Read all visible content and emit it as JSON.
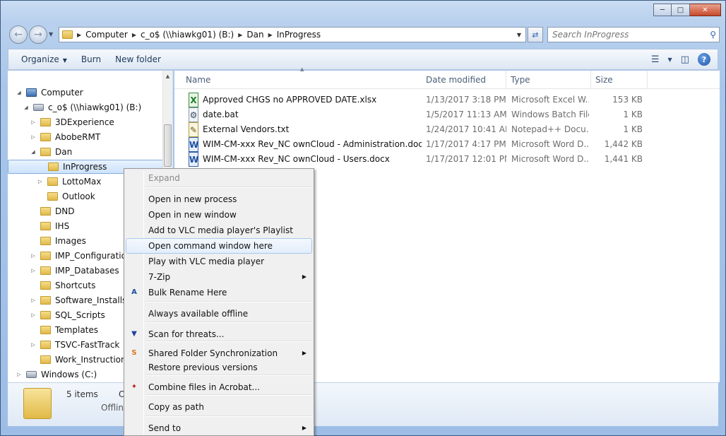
{
  "window": {
    "caption_buttons": [
      "minimize",
      "maximize",
      "close"
    ]
  },
  "address_bar": {
    "crumbs": [
      "Computer",
      "c_o$ (\\\\hiawkg01) (B:)",
      "Dan",
      "InProgress"
    ]
  },
  "search": {
    "placeholder": "Search InProgress"
  },
  "toolbar": {
    "organize": "Organize",
    "burn": "Burn",
    "new_folder": "New folder"
  },
  "nav_tree": [
    {
      "label": "Computer",
      "icon": "computer-icon",
      "expanded": true
    },
    {
      "label": "c_o$ (\\\\hiawkg01) (B:)",
      "icon": "network-drive-icon",
      "expanded": true
    },
    {
      "label": "3DExperience",
      "icon": "folder-icon"
    },
    {
      "label": "AbobeRMT",
      "icon": "folder-icon"
    },
    {
      "label": "Dan",
      "icon": "folder-icon",
      "expanded": true
    },
    {
      "label": "InProgress",
      "icon": "folder-icon",
      "selected": true
    },
    {
      "label": "LottoMax",
      "icon": "folder-icon"
    },
    {
      "label": "Outlook",
      "icon": "folder-icon"
    },
    {
      "label": "DND",
      "icon": "folder-icon"
    },
    {
      "label": "IHS",
      "icon": "folder-icon"
    },
    {
      "label": "Images",
      "icon": "folder-icon"
    },
    {
      "label": "IMP_Configuration",
      "icon": "folder-icon"
    },
    {
      "label": "IMP_Databases",
      "icon": "folder-icon"
    },
    {
      "label": "Shortcuts",
      "icon": "folder-icon"
    },
    {
      "label": "Software_Installs",
      "icon": "folder-icon"
    },
    {
      "label": "SQL_Scripts",
      "icon": "folder-icon"
    },
    {
      "label": "Templates",
      "icon": "folder-icon"
    },
    {
      "label": "TSVC-FastTrack",
      "icon": "folder-icon"
    },
    {
      "label": "Work_Instructions",
      "icon": "folder-icon"
    },
    {
      "label": "Windows (C:)",
      "icon": "local-drive-icon"
    }
  ],
  "columns": [
    "Name",
    "Date modified",
    "Type",
    "Size"
  ],
  "files": [
    {
      "name": "Approved CHGS no APPROVED DATE.xlsx",
      "date": "1/13/2017 3:18 PM",
      "type": "Microsoft Excel W...",
      "size": "153 KB",
      "icon": "excel-file-icon"
    },
    {
      "name": "date.bat",
      "date": "1/5/2017 11:13 AM",
      "type": "Windows Batch File",
      "size": "1 KB",
      "icon": "batch-file-icon"
    },
    {
      "name": "External Vendors.txt",
      "date": "1/24/2017 10:41 AM",
      "type": "Notepad++ Docu...",
      "size": "1 KB",
      "icon": "text-file-icon"
    },
    {
      "name": "WIM-CM-xxx Rev_NC ownCloud - Administration.docx",
      "date": "1/17/2017 4:17 PM",
      "type": "Microsoft Word D...",
      "size": "1,442 KB",
      "icon": "word-file-icon"
    },
    {
      "name": "WIM-CM-xxx Rev_NC ownCloud - Users.docx",
      "date": "1/17/2017 12:01 PM",
      "type": "Microsoft Word D...",
      "size": "1,441 KB",
      "icon": "word-file-icon"
    }
  ],
  "details": {
    "count": "5 items",
    "offline_partial": "O",
    "offline_label": "Offline"
  },
  "context_menu": {
    "items": [
      {
        "label": "Expand",
        "disabled": true
      },
      {
        "label": "Open in new process"
      },
      {
        "label": "Open in new window"
      },
      {
        "label": "Add to VLC media player's Playlist"
      },
      {
        "label": "Open command window here",
        "highlighted": true
      },
      {
        "label": "Play with VLC media player"
      },
      {
        "label": "7-Zip",
        "submenu": true
      },
      {
        "label": "Bulk Rename Here",
        "icon": "bulk-rename-icon"
      },
      {
        "label": "Always available offline"
      },
      {
        "label": "Scan for threats...",
        "icon": "shield-icon"
      },
      {
        "label": "Shared Folder Synchronization",
        "submenu": true,
        "icon": "sync-icon"
      },
      {
        "label": "Restore previous versions"
      },
      {
        "label": "Combine files in Acrobat...",
        "icon": "acrobat-icon"
      },
      {
        "label": "Copy as path"
      },
      {
        "label": "Send to",
        "submenu": true
      }
    ]
  }
}
